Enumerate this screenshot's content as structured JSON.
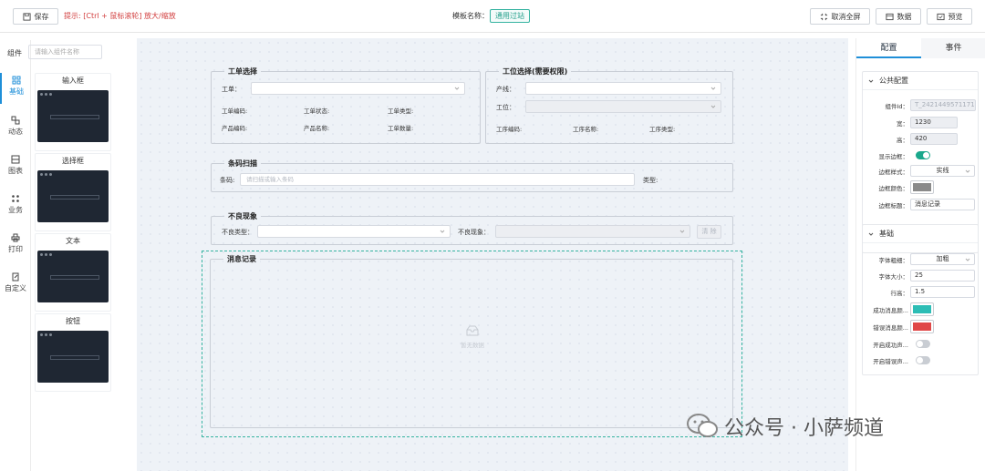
{
  "toolbar": {
    "save_label": "保存",
    "hint": "提示: [Ctrl + 鼠标滚轮] 放大/缩放",
    "template_label": "模板名称：",
    "template_name": "通用过站",
    "exit_fullscreen_label": "取消全屏",
    "data_label": "数据",
    "preview_label": "预览"
  },
  "sidebar": {
    "component_label": "组件",
    "search_placeholder": "请输入组件名称",
    "nav": [
      {
        "label": "基础",
        "icon": "grid-icon",
        "active": true
      },
      {
        "label": "动态",
        "icon": "dynamic-icon"
      },
      {
        "label": "图表",
        "icon": "chart-icon"
      },
      {
        "label": "业务",
        "icon": "business-icon"
      },
      {
        "label": "打印",
        "icon": "printer-icon"
      },
      {
        "label": "自定义",
        "icon": "custom-icon"
      }
    ],
    "components": [
      {
        "label": "输入框"
      },
      {
        "label": "选择框"
      },
      {
        "label": "文本"
      },
      {
        "label": "按钮"
      }
    ]
  },
  "canvas": {
    "order_group": {
      "title": "工单选择",
      "order_label": "工单：",
      "fields": [
        "工单编码:",
        "工单状态:",
        "工单类型:",
        "产品编码:",
        "产品名称:",
        "工单数量:"
      ]
    },
    "station_group": {
      "title": "工位选择(需要权限)",
      "line_label": "产线：",
      "station_label": "工位：",
      "fields": [
        "工序编码:",
        "工序名称:",
        "工序类型:"
      ]
    },
    "barcode_group": {
      "title": "条码扫描",
      "barcode_label": "条码:",
      "barcode_placeholder": "请扫描或输入条码",
      "type_label": "类型:"
    },
    "defect_group": {
      "title": "不良现象",
      "defect_type_label": "不良类型：",
      "defect_label": "不良现象：",
      "clear_label": "清 除"
    },
    "message_group": {
      "title": "消息记录",
      "empty_text": "暂无数据"
    }
  },
  "panel": {
    "tabs": [
      {
        "label": "配置",
        "active": true
      },
      {
        "label": "事件"
      }
    ],
    "public": {
      "title": "公共配置",
      "rows": [
        {
          "label": "组件Id：",
          "value": "T_2421449571171"
        },
        {
          "label": "宽：",
          "value": "1230"
        },
        {
          "label": "高：",
          "value": "420"
        },
        {
          "label": "显示边框：",
          "value": "on"
        },
        {
          "label": "边框样式：",
          "value": "实线"
        },
        {
          "label": "边框颜色：",
          "value": "#8a8a8a"
        },
        {
          "label": "边框标题：",
          "value": "消息记录"
        }
      ]
    },
    "basic": {
      "title": "基础",
      "rows": [
        {
          "label": "字体粗细：",
          "value": "加粗"
        },
        {
          "label": "字体大小：",
          "value": "25"
        },
        {
          "label": "行高：",
          "value": "1.5"
        },
        {
          "label": "成功消息颜...",
          "value": "#2dbdb5"
        },
        {
          "label": "错误消息颜...",
          "value": "#e04848"
        },
        {
          "label": "开启成功声...",
          "value": "off"
        },
        {
          "label": "开启错误声...",
          "value": "off"
        }
      ]
    }
  },
  "watermark": {
    "text": "公众号 · 小萨频道"
  }
}
